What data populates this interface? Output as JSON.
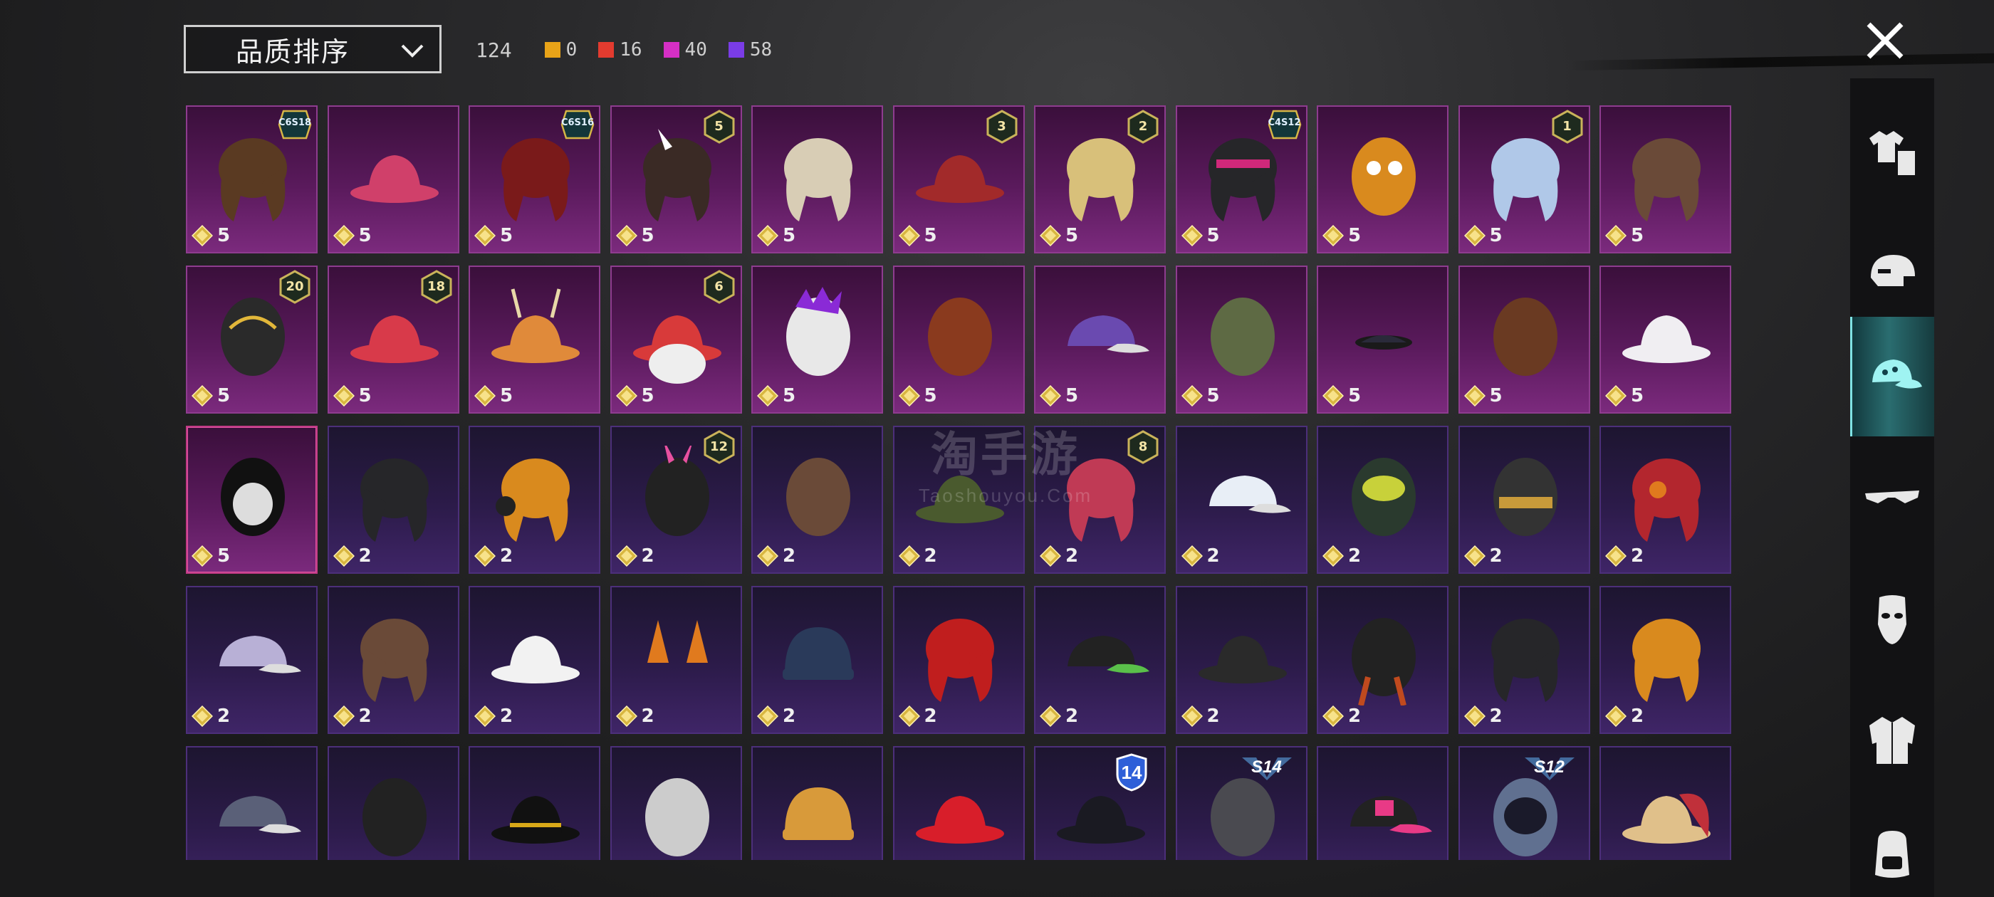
{
  "header": {
    "sort_label": "品质排序",
    "total": "124",
    "quality_counts": [
      {
        "color": "#e8a318",
        "value": "0"
      },
      {
        "color": "#e33b2f",
        "value": "16"
      },
      {
        "color": "#d52fc5",
        "value": "40"
      },
      {
        "color": "#7a3ce6",
        "value": "58"
      }
    ]
  },
  "watermark": {
    "main": "淘手游",
    "sub": "Taoshouyou.Com"
  },
  "side_nav": [
    {
      "icon": "outfit-icon",
      "active": false
    },
    {
      "icon": "helmet-icon",
      "active": false
    },
    {
      "icon": "cap-icon",
      "active": true
    },
    {
      "icon": "glasses-icon",
      "active": false
    },
    {
      "icon": "mask-icon",
      "active": false
    },
    {
      "icon": "jacket-icon",
      "active": false
    },
    {
      "icon": "backpack-icon",
      "active": false
    }
  ],
  "grid": {
    "rows": [
      [
        {
          "name": "brown-hair-icon",
          "cost": "5",
          "badge": {
            "type": "season",
            "text": "C6S18"
          },
          "q": "leg"
        },
        {
          "name": "witch-hat-icon",
          "cost": "5",
          "q": "leg"
        },
        {
          "name": "red-hair-icon",
          "cost": "5",
          "badge": {
            "type": "season",
            "text": "C6S16"
          },
          "q": "leg"
        },
        {
          "name": "bunny-ear-hair-icon",
          "cost": "5",
          "badge": {
            "type": "level",
            "text": "5"
          },
          "q": "leg"
        },
        {
          "name": "curly-blonde-hair-icon",
          "cost": "5",
          "q": "leg"
        },
        {
          "name": "jester-hat-icon",
          "cost": "5",
          "badge": {
            "type": "level",
            "text": "3"
          },
          "q": "leg"
        },
        {
          "name": "headband-hair-icon",
          "cost": "5",
          "badge": {
            "type": "level",
            "text": "2"
          },
          "q": "leg"
        },
        {
          "name": "visor-hair-icon",
          "cost": "5",
          "badge": {
            "type": "season",
            "text": "C4S12"
          },
          "q": "leg"
        },
        {
          "name": "potato-head-icon",
          "cost": "5",
          "q": "leg"
        },
        {
          "name": "icy-hair-icon",
          "cost": "5",
          "badge": {
            "type": "level",
            "text": "1"
          },
          "q": "leg"
        },
        {
          "name": "ponytail-hair-icon",
          "cost": "5",
          "q": "leg"
        }
      ],
      [
        {
          "name": "gold-helmet-icon",
          "cost": "5",
          "badge": {
            "type": "level",
            "text": "20"
          },
          "q": "leg"
        },
        {
          "name": "top-hat-icon",
          "cost": "5",
          "badge": {
            "type": "level",
            "text": "18"
          },
          "q": "leg"
        },
        {
          "name": "antler-hat-icon",
          "cost": "5",
          "q": "leg"
        },
        {
          "name": "santa-hat-icon",
          "cost": "5",
          "badge": {
            "type": "level",
            "text": "6"
          },
          "q": "leg"
        },
        {
          "name": "punk-skull-icon",
          "cost": "5",
          "q": "leg"
        },
        {
          "name": "spike-mask-icon",
          "cost": "5",
          "q": "leg"
        },
        {
          "name": "galaxy-cap-icon",
          "cost": "5",
          "q": "leg"
        },
        {
          "name": "army-helmet-icon",
          "cost": "5",
          "q": "leg"
        },
        {
          "name": "dark-item-icon",
          "cost": "5",
          "q": "leg"
        },
        {
          "name": "bear-head-icon",
          "cost": "5",
          "q": "leg"
        },
        {
          "name": "white-bucket-hat-icon",
          "cost": "5",
          "q": "leg"
        }
      ],
      [
        {
          "name": "skull-balaclava-icon",
          "cost": "5",
          "q": "leg",
          "sel": true
        },
        {
          "name": "black-hair-icon",
          "cost": "2",
          "q": "epic"
        },
        {
          "name": "headphone-hair-icon",
          "cost": "2",
          "q": "epic"
        },
        {
          "name": "bunny-helmet-icon",
          "cost": "2",
          "badge": {
            "type": "level",
            "text": "12"
          },
          "q": "epic"
        },
        {
          "name": "horn-headband-icon",
          "cost": "2",
          "q": "epic"
        },
        {
          "name": "officer-cap-icon",
          "cost": "2",
          "q": "epic"
        },
        {
          "name": "green-skull-hair-icon",
          "cost": "2",
          "badge": {
            "type": "level",
            "text": "8"
          },
          "q": "epic"
        },
        {
          "name": "white-cap-icon",
          "cost": "2",
          "q": "epic"
        },
        {
          "name": "gas-mask-helmet-icon",
          "cost": "2",
          "q": "epic"
        },
        {
          "name": "visor-helmet-icon",
          "cost": "2",
          "q": "epic"
        },
        {
          "name": "goggles-hair-icon",
          "cost": "2",
          "q": "epic"
        }
      ],
      [
        {
          "name": "polka-cap-icon",
          "cost": "2",
          "q": "epic"
        },
        {
          "name": "bucket-hat-hair-icon",
          "cost": "2",
          "q": "epic"
        },
        {
          "name": "sun-hat-icon",
          "cost": "2",
          "q": "epic"
        },
        {
          "name": "fox-ears-icon",
          "cost": "2",
          "q": "epic"
        },
        {
          "name": "navy-beanie-icon",
          "cost": "2",
          "q": "epic"
        },
        {
          "name": "red-mohawk-icon",
          "cost": "2",
          "q": "epic"
        },
        {
          "name": "green-cap-icon",
          "cost": "2",
          "q": "epic"
        },
        {
          "name": "steampunk-hat-icon",
          "cost": "2",
          "q": "epic"
        },
        {
          "name": "tribal-mask-icon",
          "cost": "2",
          "q": "epic"
        },
        {
          "name": "bob-hair-icon",
          "cost": "2",
          "q": "epic"
        },
        {
          "name": "long-hair-icon",
          "cost": "2",
          "q": "epic"
        }
      ],
      [
        {
          "name": "grey-cap-icon",
          "cost": "",
          "q": "epic"
        },
        {
          "name": "respirator-icon",
          "cost": "",
          "q": "epic"
        },
        {
          "name": "fedora-icon",
          "cost": "",
          "q": "epic"
        },
        {
          "name": "goggle-helmet-icon",
          "cost": "",
          "q": "epic"
        },
        {
          "name": "yellow-beanie-icon",
          "cost": "",
          "q": "epic"
        },
        {
          "name": "mushroom-hat-icon",
          "cost": "",
          "q": "epic"
        },
        {
          "name": "police-cap-icon",
          "cost": "",
          "badge": {
            "type": "number",
            "text": "14"
          },
          "q": "epic"
        },
        {
          "name": "knight-helmet-icon",
          "cost": "",
          "badge": {
            "type": "wing",
            "text": "S14"
          },
          "q": "epic"
        },
        {
          "name": "pink-cap-icon",
          "cost": "",
          "q": "epic"
        },
        {
          "name": "space-helmet-icon",
          "cost": "",
          "badge": {
            "type": "wing",
            "text": "S12"
          },
          "q": "epic"
        },
        {
          "name": "bread-hat-icon",
          "cost": "",
          "q": "epic"
        }
      ]
    ]
  }
}
